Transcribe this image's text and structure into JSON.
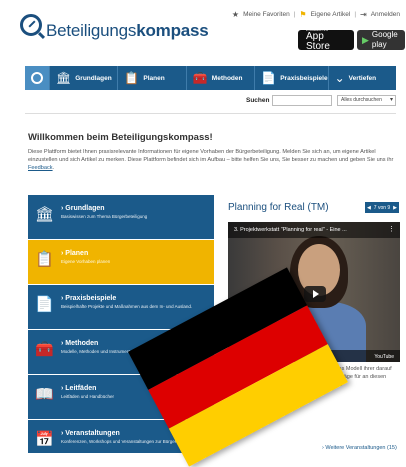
{
  "toplinks": {
    "favorites": "Meine Favoriten",
    "articles": "Eigene Artikel",
    "login": "Anmelden"
  },
  "logo": {
    "part1": "Beteiligungs",
    "part2": "kompass"
  },
  "stores": {
    "apple_small": "Erhältlich im",
    "apple_big": "App Store",
    "google_big": "Google play"
  },
  "nav": {
    "items": [
      {
        "label": "Grundlagen",
        "icon": "building-icon"
      },
      {
        "label": "Planen",
        "icon": "clipboard-icon"
      },
      {
        "label": "Methoden",
        "icon": "toolbox-icon"
      },
      {
        "label": "Praxisbeispiele",
        "icon": "document-icon"
      },
      {
        "label": "Vertiefen",
        "icon": "chevron-down-icon"
      }
    ]
  },
  "search": {
    "label": "Suchen",
    "placeholder": "",
    "scope": "Alles durchsuchen"
  },
  "welcome": {
    "title": "Willkommen beim Beteiligungskompass!",
    "intro": "Diese Plattform bietet Ihnen praxisrelevante Informationen für eigene Vorhaben der Bürgerbeteiligung. Melden Sie sich an, um eigene Artikel einzustellen und sich Artikel zu merken. Diese Plattform befindet sich im Aufbau – bitte helfen Sie uns, Sie besser zu machen und geben Sie uns ihr",
    "intro_link": "Feedback"
  },
  "menu": [
    {
      "title": "› Grundlagen",
      "subtitle": "Basiswissen zum Thema Bürgerbeteiligung",
      "active": false
    },
    {
      "title": "› Planen",
      "subtitle": "Eigene Vorhaben planen",
      "active": true
    },
    {
      "title": "› Praxisbeispiele",
      "subtitle": "Beispielhafte Projekte und Maßnahmen aus dem In- und Ausland.",
      "active": false
    },
    {
      "title": "› Methoden",
      "subtitle": "Modelle, Methoden und Instrumente zur Bürgerbeteiligung",
      "active": false
    },
    {
      "title": "› Leitfäden",
      "subtitle": "Leitfäden und Handbücher",
      "active": false
    },
    {
      "title": "› Veranstaltungen",
      "subtitle": "Konferenzen, Workshops und Veranstaltungen zur Bürgerbeteiligung",
      "active": false
    }
  ],
  "panel": {
    "title": "Planning for Real (TM)",
    "pager": "7 von 9",
    "video_title": "3. Projektwerkstatt \"Planning for real\" - Eine ...",
    "video_logo": "YouTube",
    "text": "dreidimensionales Modell ihrer darauf basierend Vorschläge für an diesen Vorschlägen eine",
    "more": "› Weitere Veranstaltungen (15)"
  },
  "colors": {
    "brand": "#1b5a8a",
    "active": "#f0b400",
    "flag_black": "#000000",
    "flag_red": "#dd0000",
    "flag_gold": "#ffce00"
  }
}
